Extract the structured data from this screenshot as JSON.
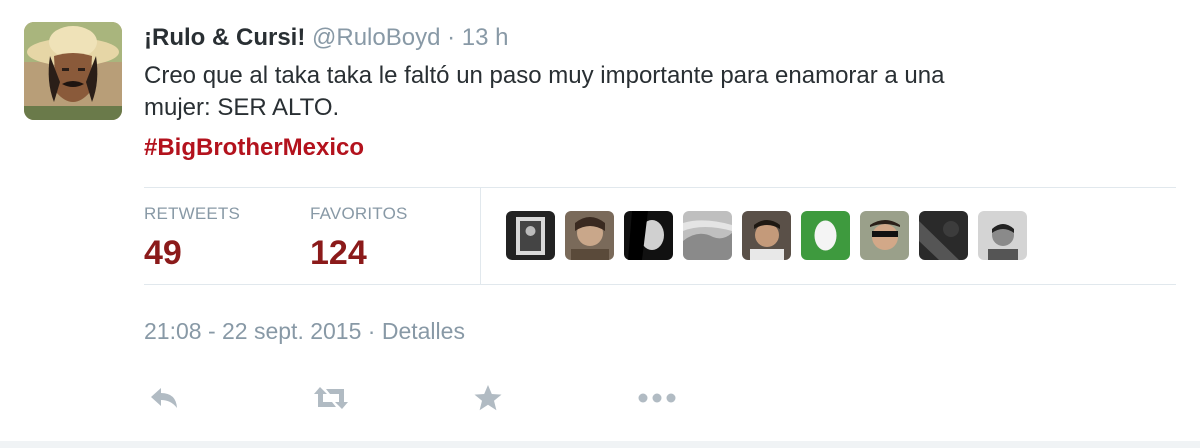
{
  "tweet": {
    "display_name": "¡Rulo & Cursi!",
    "handle": "@RuloBoyd",
    "separator": "·",
    "time": "13 h",
    "text_line1": "Creo que al taka taka le faltó un paso muy importante para enamorar a una",
    "text_line2": "mujer: SER ALTO.",
    "hashtag": "#BigBrotherMexico"
  },
  "stats": {
    "retweets_label": "RETWEETS",
    "retweets_value": "49",
    "favorites_label": "FAVORITOS",
    "favorites_value": "124"
  },
  "favoriters": [
    "avatar-1",
    "avatar-2",
    "avatar-3",
    "avatar-4",
    "avatar-5",
    "avatar-6",
    "avatar-7",
    "avatar-8",
    "avatar-9"
  ],
  "footer": {
    "timestamp": "21:08 - 22 sept. 2015",
    "separator": "·",
    "details_link": "Detalles"
  },
  "actions": [
    {
      "name": "reply",
      "icon": "reply-icon"
    },
    {
      "name": "retweet",
      "icon": "retweet-icon"
    },
    {
      "name": "favorite",
      "icon": "star-icon"
    },
    {
      "name": "more",
      "icon": "more-icon"
    }
  ],
  "colors": {
    "hashtag": "#b3121d",
    "stat_value": "#8b1a1a",
    "muted": "#8899a6",
    "text": "#292f33",
    "divider": "#e1e8ed"
  }
}
